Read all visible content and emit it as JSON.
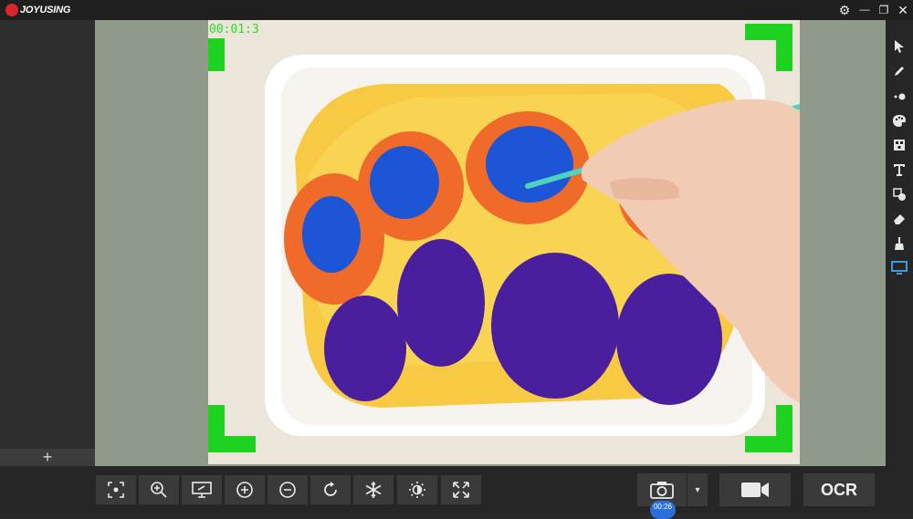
{
  "app": {
    "logo_text": "JOYUSING",
    "brand_color": "#d8262c"
  },
  "window_controls": {
    "settings": "⚙",
    "minimize": "—",
    "restore": "❐",
    "close": "✕"
  },
  "sidebar": {
    "add_label": "+"
  },
  "preview": {
    "timestamp": "00:01:3",
    "overlay_color": "#1fd21f"
  },
  "right_toolbar": {
    "tools": [
      "cursor-icon",
      "pen-icon",
      "laser-dots-icon",
      "palette-icon",
      "mosaic-icon",
      "text-icon",
      "shapes-icon",
      "eraser-icon",
      "broom-icon",
      "monitor-icon"
    ],
    "active_tool": "monitor-icon",
    "active_color": "#3a9be0"
  },
  "bottom_toolbar": {
    "buttons": [
      "focus-icon",
      "zoom-in-icon",
      "screen-share-icon",
      "plus-circle-icon",
      "minus-circle-icon",
      "rotate-icon",
      "snowflake-icon",
      "brightness-icon",
      "fullscreen-icon"
    ],
    "capture_dropdown": "▾",
    "timer_badge": "00:26",
    "ocr_label": "OCR"
  }
}
